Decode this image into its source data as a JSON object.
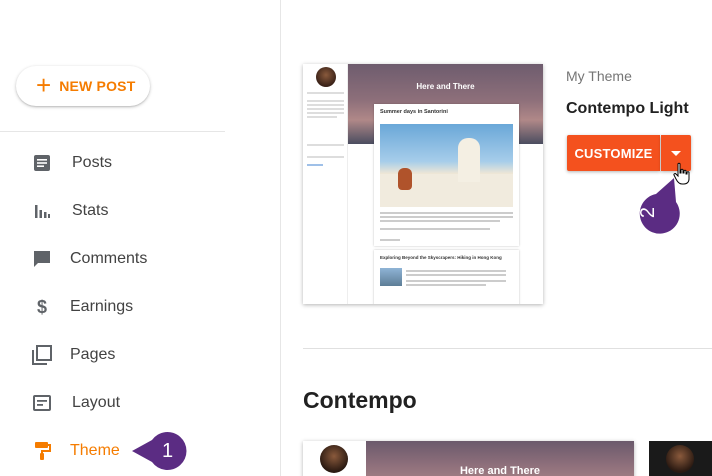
{
  "sidebar": {
    "new_post_label": "NEW POST",
    "items": [
      {
        "label": "Posts",
        "icon": "posts-icon"
      },
      {
        "label": "Stats",
        "icon": "stats-icon"
      },
      {
        "label": "Comments",
        "icon": "comments-icon"
      },
      {
        "label": "Earnings",
        "icon": "dollar-icon"
      },
      {
        "label": "Pages",
        "icon": "pages-icon"
      },
      {
        "label": "Layout",
        "icon": "layout-icon"
      },
      {
        "label": "Theme",
        "icon": "paint-roller-icon",
        "active": true
      }
    ]
  },
  "current_theme": {
    "section_label": "My Theme",
    "name": "Contempo Light",
    "customize_label": "CUSTOMIZE",
    "preview": {
      "blog_title": "Here and There",
      "post1_title": "Summer days in Santorini",
      "post2_title": "Exploring Beyond the Skyscrapers: Hiking in Hong Kong"
    }
  },
  "gallery": {
    "section_title": "Contempo",
    "thumb_blog_title": "Here and There"
  },
  "callouts": {
    "step1": "1",
    "step2": "2"
  },
  "colors": {
    "accent_orange": "#f57c00",
    "customize_button": "#f4511e",
    "callout_purple": "#5b2c83"
  }
}
